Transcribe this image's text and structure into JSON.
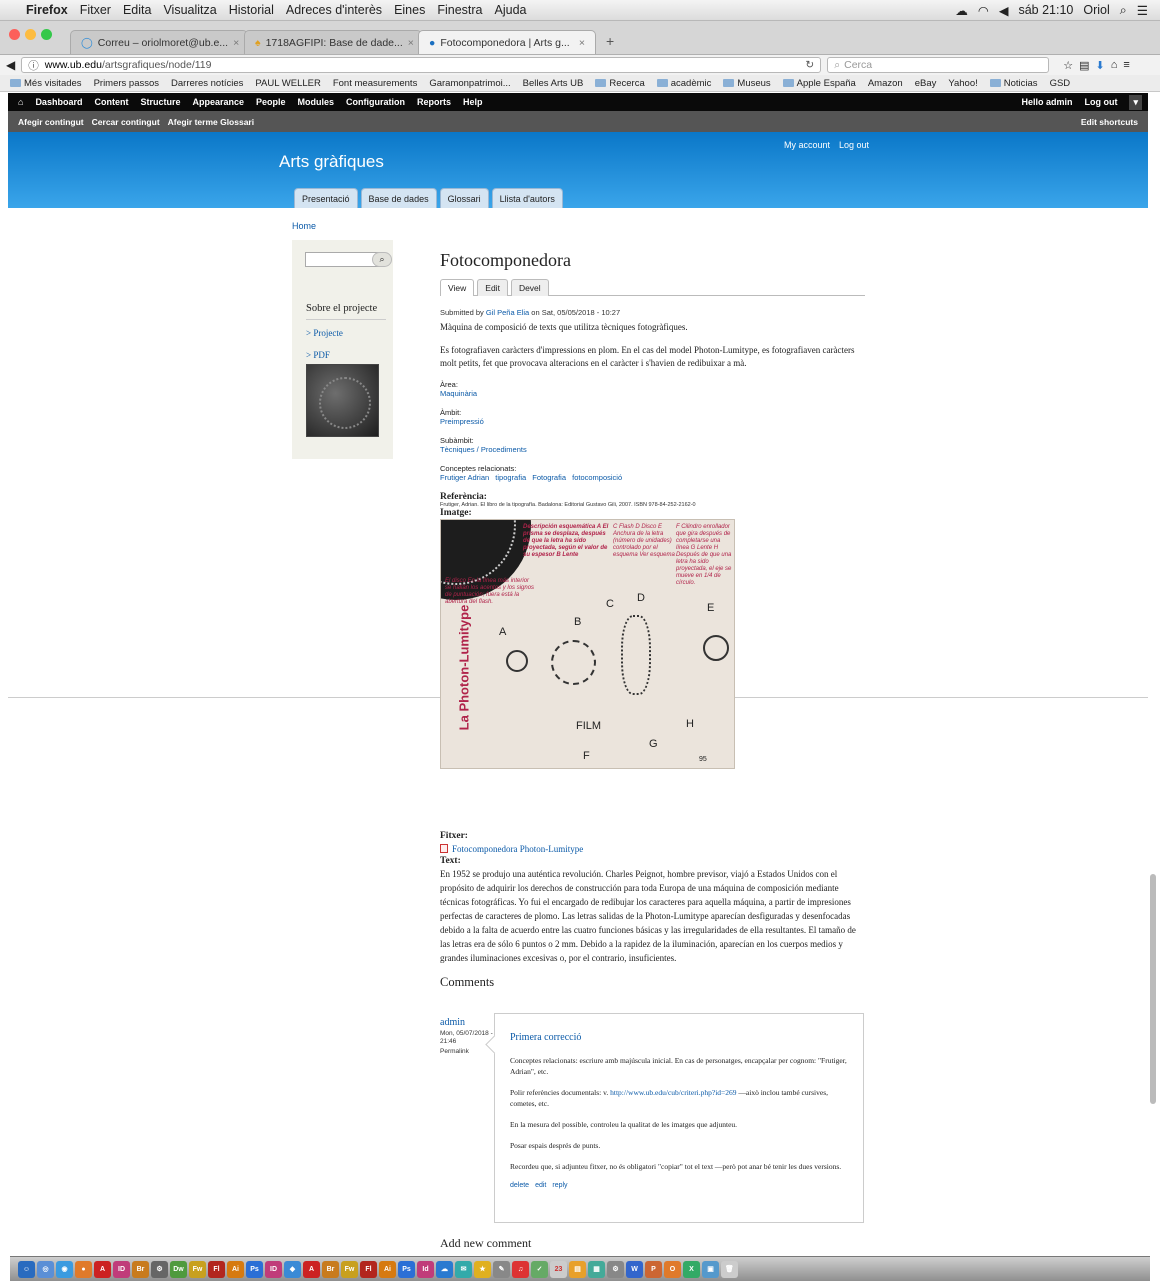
{
  "macbar": {
    "menus": [
      "Firefox",
      "Fitxer",
      "Edita",
      "Visualitza",
      "Historial",
      "Adreces d'interès",
      "Eines",
      "Finestra",
      "Ajuda"
    ],
    "clock": "sáb 21:10",
    "user": "Oriol"
  },
  "browser": {
    "tabs": [
      {
        "label": "Correu – oriolmoret@ub.e...",
        "active": false
      },
      {
        "label": "1718AGFIPI: Base de dade...",
        "active": false
      },
      {
        "label": "Fotocomponedora | Arts g...",
        "active": true
      }
    ],
    "url_host": "www.ub.edu",
    "url_path": "/artsgrafiques/node/119",
    "search_placeholder": "Cerca",
    "bookmarks": [
      "Més visitades",
      "Primers passos",
      "Darreres notícies",
      "PAUL WELLER",
      "Font measurements",
      "Garamonpatrimoi...",
      "Belles Arts UB",
      "Recerca",
      "acadèmic",
      "Museus",
      "Apple España",
      "Amazon",
      "eBay",
      "Yahoo!",
      "Noticias",
      "GSD"
    ]
  },
  "admin": {
    "items": [
      "Dashboard",
      "Content",
      "Structure",
      "Appearance",
      "People",
      "Modules",
      "Configuration",
      "Reports",
      "Help"
    ],
    "hello": "Hello admin",
    "logout": "Log out",
    "shortcuts": [
      "Afegir contingut",
      "Cercar contingut",
      "Afegir terme Glossari"
    ],
    "edit_shortcuts": "Edit shortcuts"
  },
  "header": {
    "site_name": "Arts gràfiques",
    "my_account": "My account",
    "log_out": "Log out",
    "tabs": [
      "Presentació",
      "Base de dades",
      "Glossari",
      "Llista d'autors"
    ]
  },
  "breadcrumb": "Home",
  "sidebar": {
    "block_title": "Sobre el projecte",
    "items": [
      "> Projecte",
      "> PDF"
    ]
  },
  "node": {
    "title": "Fotocomponedora",
    "tabs": [
      "View",
      "Edit",
      "Devel"
    ],
    "submitted_prefix": "Submitted by ",
    "author": "Gil Peña Elia",
    "submitted_suffix": " on Sat, 05/05/2018 - 10:27",
    "summary": "Màquina de composició de texts que utilitza tècniques fotogràfiques.",
    "body": "Es fotografiaven caràcters d'impressions en plom. En el cas del model Photon-Lumitype, es fotografiaven caràcters molt petits, fet que provocava alteracions en el caràcter i s'havien de redibuixar a mà.",
    "area_label": "Àrea:",
    "area": "Maquinària",
    "ambit_label": "Àmbit:",
    "ambit": "Preimpressió",
    "subambit_label": "Subàmbit:",
    "subambit": "Tècniques / Procediments",
    "concepts_label": "Conceptes relacionats:",
    "concepts": [
      "Frutiger Adrian",
      "tipografia",
      "Fotografia",
      "fotocomposició"
    ],
    "ref_label": "Referència:",
    "ref": "Frutiger, Adrian. El libro de la tipografía. Badalona: Editorial Gustavo Gili, 2007. ISBN 978-84-252-2162-0",
    "image_label": "Imatge:",
    "image": {
      "vertical": "La Photon-Lumitype",
      "letters": [
        "A",
        "B",
        "C",
        "D",
        "E",
        "F",
        "G",
        "H"
      ],
      "film": "FILM",
      "page": "95",
      "ann1": "Descripción esquemática A El prisma se desplaza, después de que la letra ha sido proyectada, según el valor de su espesor B Lente",
      "ann2": "C Flash D Disco E Anchura de la letra (número de unidades) controlado por el esquema Ver esquema",
      "ann3": "F Cilindro enrollador que gira después de completarse una línea G Lente H Después de que una letra ha sido proyectada, el eje se mueve en 1/4 de círculo.",
      "ann4": "El disco En la línea más interior se hallan los acentos y los signos de puntuación; fuera está la abertura del flash."
    },
    "file_label": "Fitxer:",
    "file": "Fotocomponedora Photon-Lumitype",
    "text_label": "Text:",
    "text": "En 1952 se produjo una auténtica revolución. Charles Peignot, hombre previsor, viajó a Estados Unidos con el propósito de adquirir los derechos de construcción para toda Europa de una máquina de composición mediante técnicas fotográficas. Yo fui el encargado de redibujar los caracteres para aquella máquina, a partir de impresiones perfectas de caracteres de plomo. Las letras salidas de la Photon-Lumitype aparecían desfiguradas y desenfocadas debido a la falta de acuerdo entre las cuatro funciones básicas y las irregularidades de ella resultantes. El tamaño de las letras era de sólo 6 puntos o 2 mm. Debido a la rapidez de la iluminación, aparecían en los cuerpos medios y grandes iluminaciones excesivas o, por el contrario, insuficientes."
  },
  "comments": {
    "title": "Comments",
    "author": "admin",
    "date": "Mon, 05/07/2018 - 21:46",
    "permalink": "Permalink",
    "subject": "Primera correcció",
    "p1": "Conceptes relacionats: escriure amb majúscula inicial. En cas de personatges, encapçalar per cognom: \"Frutiger, Adrian\", etc.",
    "p2_prefix": "Polir referències documentals: v. ",
    "p2_link": "http://www.ub.edu/cub/criteri.php?id=269",
    "p2_suffix": " —això inclou també cursives, cometes, etc.",
    "p3": "En la mesura del possible, controleu la qualitat de les imatges que adjunteu.",
    "p4": "Posar espais després de punts.",
    "p5": "Recordeu que, si adjunteu fitxer, no és obligatori \"copiar\" tot el text —però pot anar bé tenir les dues versions.",
    "links": [
      "delete",
      "edit",
      "reply"
    ],
    "add_new": "Add new comment"
  },
  "dock": {
    "icons": [
      "ID",
      "Br",
      "Dw",
      "Fw",
      "Fl",
      "Ai",
      "Ps",
      "ID",
      "Br",
      "Fw",
      "Fl",
      "Ai",
      "Ps",
      "Id"
    ]
  },
  "colors": {
    "header_top": "#0a77c8",
    "header_bottom": "#3aa5ea",
    "link": "#0b5aa8"
  }
}
